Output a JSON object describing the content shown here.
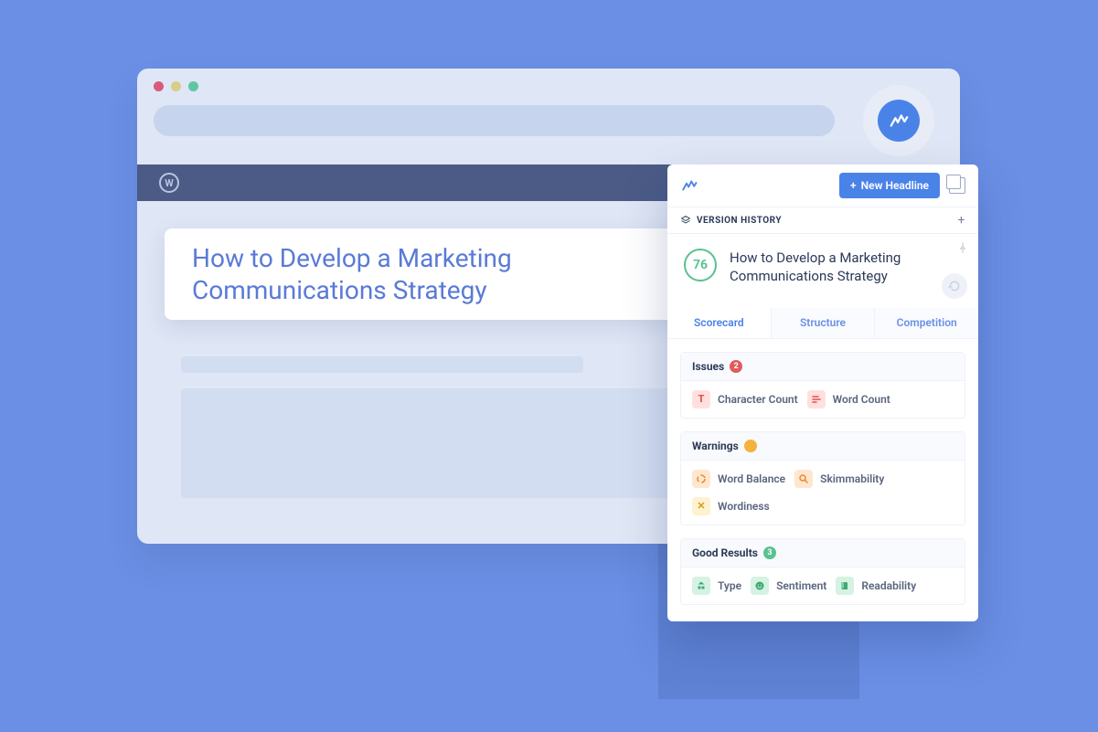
{
  "editor": {
    "headline": "How to Develop a Marketing Communications Strategy"
  },
  "panel": {
    "new_headline_label": "New Headline",
    "version_history_label": "VERSION HISTORY",
    "score": "76",
    "headline": "How to Develop a Marketing Communications Strategy",
    "tabs": {
      "scorecard": "Scorecard",
      "structure": "Structure",
      "competition": "Competition"
    },
    "sections": {
      "issues": {
        "title": "Issues",
        "count": "2",
        "items": {
          "character_count": "Character Count",
          "word_count": "Word Count"
        }
      },
      "warnings": {
        "title": "Warnings",
        "items": {
          "word_balance": "Word Balance",
          "skimmability": "Skimmability",
          "wordiness": "Wordiness"
        }
      },
      "good": {
        "title": "Good Results",
        "count": "3",
        "items": {
          "type": "Type",
          "sentiment": "Sentiment",
          "readability": "Readability"
        }
      }
    }
  }
}
